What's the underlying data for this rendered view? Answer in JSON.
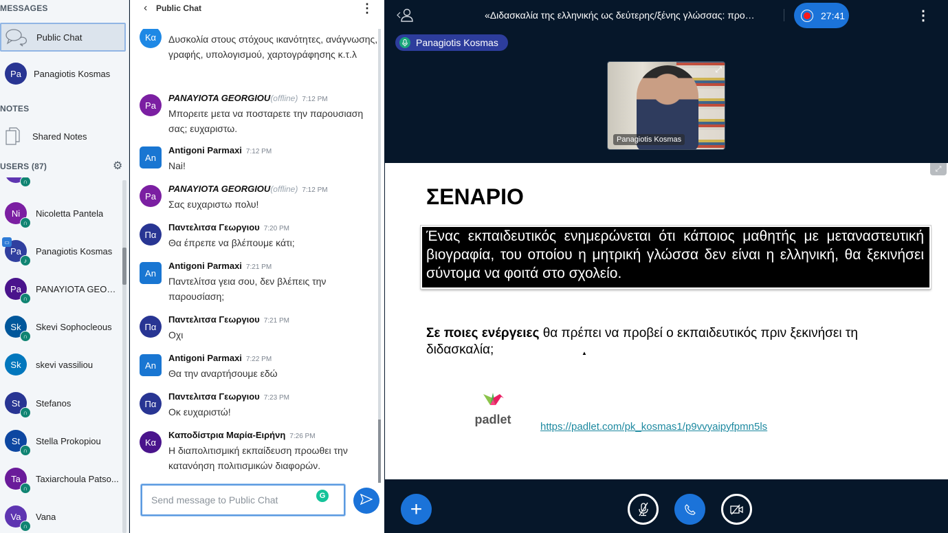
{
  "userlist": {
    "messages_title": "MESSAGES",
    "messages": [
      {
        "label": "Public Chat",
        "icon": "chat-bubbles-icon",
        "active": true
      },
      {
        "label": "Panagiotis Kosmas",
        "initials": "Pa",
        "color": "#283593"
      }
    ],
    "notes_title": "NOTES",
    "notes": [
      {
        "label": "Shared Notes",
        "icon": "document-icon"
      }
    ],
    "users_title": "USERS (87)",
    "users": [
      {
        "initials": "",
        "name": "",
        "color": "#5e35b1",
        "status": "listen-only"
      },
      {
        "initials": "Ni",
        "name": "Nicoletta Pantela",
        "color": "#7b1fa2",
        "status": "listen-only"
      },
      {
        "initials": "Pa",
        "name": "Panagiotis Kosmas",
        "color": "#303f9f",
        "status": "microphone",
        "presenter": true
      },
      {
        "initials": "Pa",
        "name": "PANAYIOTA GEORGI...",
        "color": "#4a148c",
        "status": "listen-only"
      },
      {
        "initials": "Sk",
        "name": "Skevi Sophocleous",
        "color": "#01579b",
        "status": "listen-only"
      },
      {
        "initials": "Sk",
        "name": "skevi vassiliou",
        "color": "#0277bd",
        "status": "none"
      },
      {
        "initials": "St",
        "name": "Stefanos",
        "color": "#283593",
        "status": "listen-only"
      },
      {
        "initials": "St",
        "name": "Stella Prokopiou",
        "color": "#0d47a1",
        "status": "listen-only"
      },
      {
        "initials": "Ta",
        "name": "Taxiarchoula Patso...",
        "color": "#6a1b9a",
        "status": "listen-only"
      },
      {
        "initials": "Va",
        "name": "Vana",
        "color": "#5e35b1",
        "status": "listen-only"
      }
    ]
  },
  "chat": {
    "title": "Public Chat",
    "messages": [
      {
        "initials": "Κα",
        "color": "#1e88e5",
        "square": false,
        "name": "",
        "offline": false,
        "time": "",
        "text": "Δυσκολία στους στόχους ικανότητες, ανάγνωσης, γραφής, υπολογισμού, χαρτογράφησης κ.τ.λ"
      },
      {
        "initials": "Pa",
        "color": "#7b1fa2",
        "square": false,
        "name": "PANAYIOTA GEORGIOU",
        "offline": true,
        "offline_label": "(offline)",
        "time": "7:12 PM",
        "text": "Μπορειτε μετα να ποσταρετε την παρουσιαση σας; ευχαριστω."
      },
      {
        "initials": "An",
        "color": "#1976d2",
        "square": true,
        "name": "Antigoni Parmaxi",
        "offline": false,
        "time": "7:12 PM",
        "text": "Nai!"
      },
      {
        "initials": "Pa",
        "color": "#7b1fa2",
        "square": false,
        "name": "PANAYIOTA GEORGIOU",
        "offline": true,
        "offline_label": "(offline)",
        "time": "7:12 PM",
        "text": "Σας ευχαριστω πολυ!"
      },
      {
        "initials": "Πα",
        "color": "#283593",
        "square": false,
        "name": "Παντελιτσα Γεωργιου",
        "offline": false,
        "time": "7:20 PM",
        "text": "Θα έπρεπε να βλέπουμε κάτι;"
      },
      {
        "initials": "An",
        "color": "#1976d2",
        "square": true,
        "name": "Antigoni Parmaxi",
        "offline": false,
        "time": "7:21 PM",
        "text": "Παντελίτσα γεια σου, δεν βλέπεις την παρουσίαση;"
      },
      {
        "initials": "Πα",
        "color": "#283593",
        "square": false,
        "name": "Παντελιτσα Γεωργιου",
        "offline": false,
        "time": "7:21 PM",
        "text": "Οχι"
      },
      {
        "initials": "An",
        "color": "#1976d2",
        "square": true,
        "name": "Antigoni Parmaxi",
        "offline": false,
        "time": "7:22 PM",
        "text": "Θα την αναρτήσουμε εδώ"
      },
      {
        "initials": "Πα",
        "color": "#283593",
        "square": false,
        "name": "Παντελιτσα Γεωργιου",
        "offline": false,
        "time": "7:23 PM",
        "text": "Οκ ευχαριστώ!"
      },
      {
        "initials": "Κα",
        "color": "#4a148c",
        "square": false,
        "name": "Καποδίστρια Μαρία-Ειρήνη",
        "offline": false,
        "time": "7:26 PM",
        "text": "Η διαπολιτισμική εκπαίδευση προωθει την κατανόηση πολιτισμικών διαφορών."
      }
    ],
    "input_placeholder": "Send message to Public Chat",
    "input_value": ""
  },
  "main": {
    "conference_title": "«Διδασκαλία της ελληνικής ως δεύτερης/ξένης γλώσσας: προ…",
    "recording_time": "27:41",
    "talker": "Panagiotis Kosmas",
    "video_name": "Panagiotis Kosmas",
    "slide": {
      "title": "ΣΕΝΑΡΙΟ",
      "box_text": "Ένας εκπαιδευτικός ενημερώνεται ότι κάποιος μαθητής με μεταναστευτική βιογραφία, του οποίου η μητρική γλώσσα δεν είναι η ελληνική, θα ξεκινήσει σύντομα να φοιτά στο σχολείο.",
      "question_bold": "Σε ποιες ενέργειες",
      "question_rest": " θα πρέπει να προβεί ο εκπαιδευτικός πριν ξεκινήσει τη διδασκαλία;",
      "logo_text": "padlet",
      "link": "https://padlet.com/pk_kosmas1/p9vvyaipyfpmn5ls"
    }
  },
  "icons": {
    "plus": "+",
    "back": "‹",
    "kebab": "⋮",
    "gear": "⚙",
    "send": "➤",
    "phone": "✆",
    "fullscreen": "⤢"
  }
}
